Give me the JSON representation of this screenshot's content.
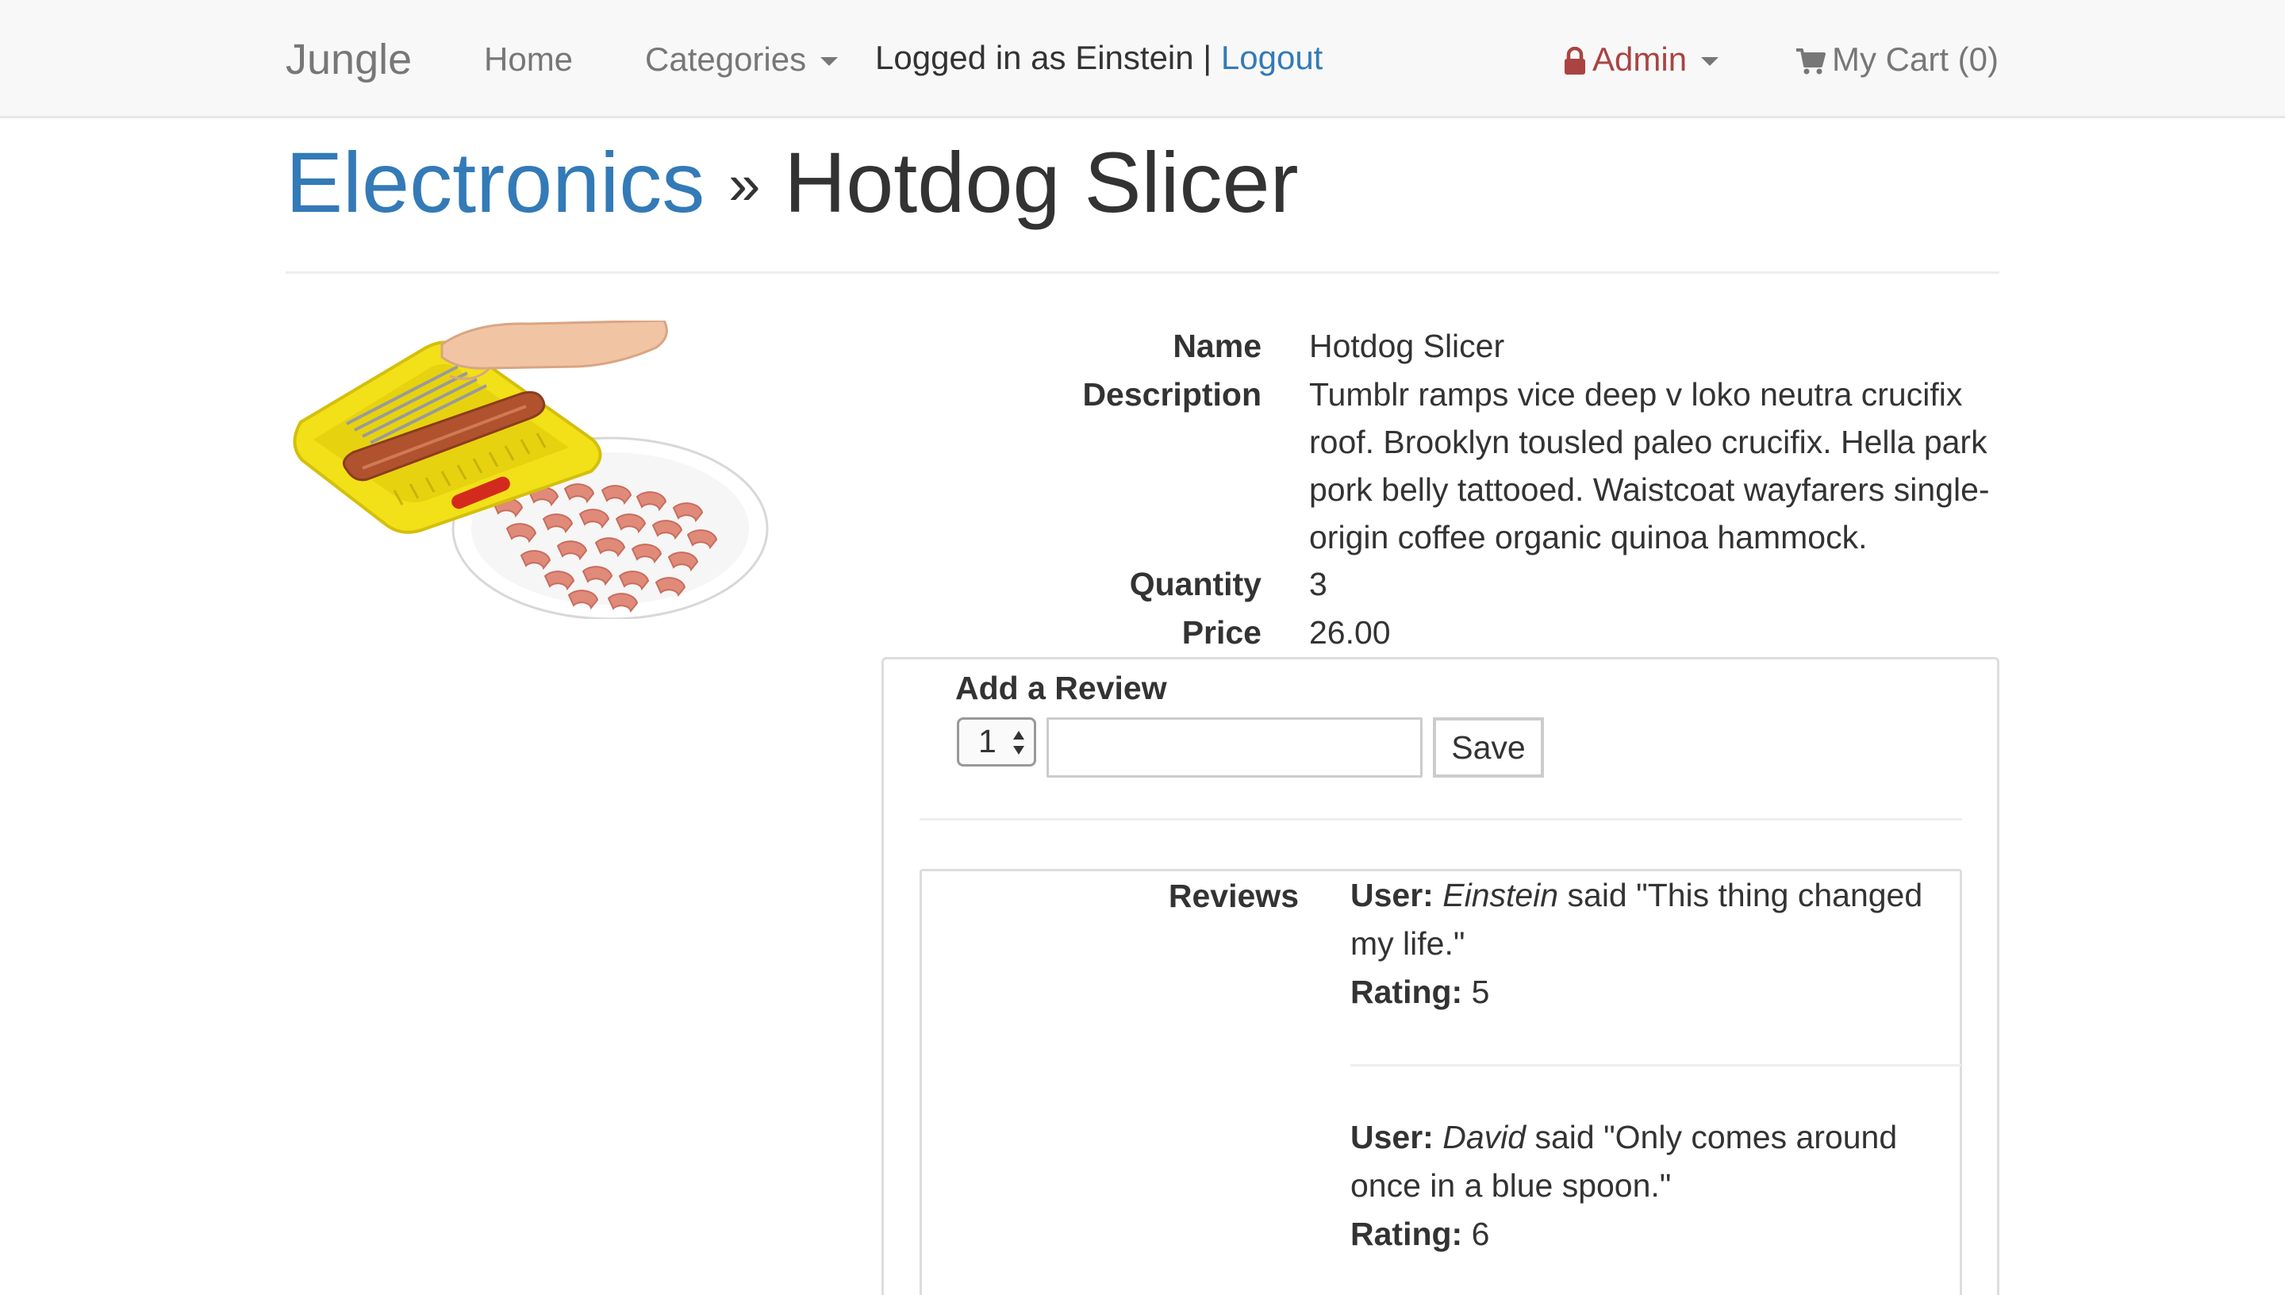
{
  "navbar": {
    "brand": "Jungle",
    "home": "Home",
    "categories": "Categories",
    "logged_in_text": "Logged in as Einstein |",
    "logout": "Logout",
    "admin": "Admin",
    "cart": "My Cart (0)"
  },
  "breadcrumb": {
    "category": "Electronics",
    "separator": "»",
    "product": "Hotdog Slicer"
  },
  "product": {
    "name_label": "Name",
    "name": "Hotdog Slicer",
    "description_label": "Description",
    "description": "Tumblr ramps vice deep v loko neutra crucifix roof. Brooklyn tousled paleo crucifix. Hella park pork belly tattooed. Waistcoat wayfarers single-origin coffee organic quinoa hammock.",
    "quantity_label": "Quantity",
    "quantity": "3",
    "price_label": "Price",
    "price": "26.00"
  },
  "review_form": {
    "title": "Add a Review",
    "rating_value": "1",
    "text_value": "",
    "save_label": "Save"
  },
  "reviews": {
    "label": "Reviews",
    "user_prefix": "User:",
    "said": "said",
    "rating_prefix": "Rating:",
    "items": [
      {
        "user": "Einstein",
        "text": "\"This thing changed my life.\"",
        "rating": "5"
      },
      {
        "user": "David",
        "text": "\"Only comes around once in a blue spoon.\"",
        "rating": "6"
      }
    ]
  },
  "colors": {
    "link": "#337ab7",
    "admin": "#a94442",
    "navbar_bg": "#f8f8f8",
    "slicer_yellow": "#f2e018"
  },
  "icons": {
    "admin": "lock-icon",
    "cart": "shopping-cart-icon"
  }
}
